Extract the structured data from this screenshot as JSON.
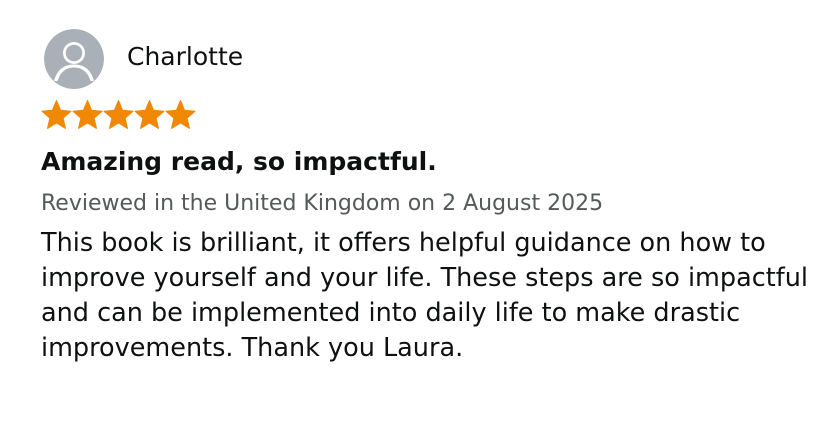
{
  "review": {
    "reviewer_name": "Charlotte",
    "rating": 5,
    "rating_max": 5,
    "star_color": "#f08804",
    "title": "Amazing read, so impactful.",
    "meta": "Reviewed in the United Kingdom on 2 August 2025",
    "body": "This book is brilliant, it offers helpful guidance on how to improve yourself and your life. These steps are so impactful and can be implemented into daily life to make drastic improvements. Thank you Laura.",
    "avatar_icon": "default-user-avatar-icon",
    "star_icon": "filled-star-icon"
  }
}
